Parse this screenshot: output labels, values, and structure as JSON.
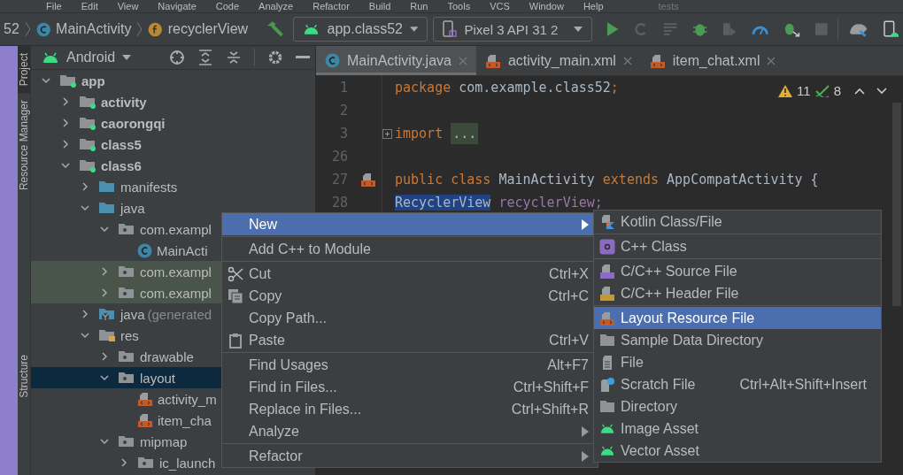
{
  "menu_bar": [
    {
      "label": "File"
    },
    {
      "label": "Edit"
    },
    {
      "label": "View"
    },
    {
      "label": "Navigate"
    },
    {
      "label": "Code"
    },
    {
      "label": "Analyze"
    },
    {
      "label": "Refactor"
    },
    {
      "label": "Build"
    },
    {
      "label": "Run"
    },
    {
      "label": "Tools"
    },
    {
      "label": "VCS"
    },
    {
      "label": "Window"
    },
    {
      "label": "Help"
    }
  ],
  "window": {
    "title": "tests"
  },
  "breadcrumbs": [
    {
      "label": "52",
      "kind": "text"
    },
    {
      "label": "MainActivity",
      "kind": "class"
    },
    {
      "label": "recyclerView",
      "kind": "field"
    }
  ],
  "run_config": {
    "label": "app.class52"
  },
  "device": {
    "label": "Pixel 3 API 31 2"
  },
  "tool_strip": [
    {
      "label": "Project",
      "selected": true
    },
    {
      "label": "Resource Manager",
      "selected": false
    },
    {
      "label": "Structure",
      "selected": false
    }
  ],
  "project_panel": {
    "view": "Android",
    "tree": [
      {
        "label": "app",
        "kind": "module",
        "expanded": true,
        "selected": false,
        "marked": false,
        "children": [
          {
            "label": "activity",
            "kind": "module",
            "expanded": false,
            "selected": false,
            "marked": false
          },
          {
            "label": "caorongqi",
            "kind": "module",
            "expanded": false,
            "selected": false,
            "marked": false
          },
          {
            "label": "class5",
            "kind": "module",
            "expanded": false,
            "selected": false,
            "marked": false
          },
          {
            "label": "class6",
            "kind": "module",
            "expanded": true,
            "selected": false,
            "marked": false,
            "children": [
              {
                "label": "manifests",
                "kind": "source-folder",
                "expanded": false,
                "selected": false,
                "marked": false
              },
              {
                "label": "java",
                "kind": "source-folder",
                "expanded": true,
                "selected": false,
                "marked": false,
                "children": [
                  {
                    "label": "com.exampl",
                    "kind": "package",
                    "expanded": true,
                    "selected": false,
                    "marked": false,
                    "children": [
                      {
                        "label": "MainActi",
                        "kind": "class",
                        "selected": false,
                        "marked": false
                      }
                    ]
                  },
                  {
                    "label": "com.exampl",
                    "kind": "package",
                    "expanded": false,
                    "selected": false,
                    "marked": true
                  },
                  {
                    "label": "com.exampl",
                    "kind": "package",
                    "expanded": false,
                    "selected": false,
                    "marked": true
                  }
                ]
              },
              {
                "label": "java",
                "note": "(generated",
                "kind": "generated",
                "expanded": false,
                "selected": false,
                "marked": false
              },
              {
                "label": "res",
                "kind": "res",
                "expanded": true,
                "selected": false,
                "marked": false,
                "children": [
                  {
                    "label": "drawable",
                    "kind": "package",
                    "expanded": false,
                    "selected": false,
                    "marked": false
                  },
                  {
                    "label": "layout",
                    "kind": "package",
                    "expanded": true,
                    "selected": true,
                    "marked": false,
                    "children": [
                      {
                        "label": "activity_m",
                        "kind": "layout",
                        "selected": false,
                        "marked": false
                      },
                      {
                        "label": "item_cha",
                        "kind": "layout",
                        "selected": false,
                        "marked": false
                      }
                    ]
                  },
                  {
                    "label": "mipmap",
                    "kind": "package",
                    "expanded": true,
                    "selected": false,
                    "marked": false,
                    "children": [
                      {
                        "label": "ic_launch",
                        "kind": "package",
                        "expanded": false,
                        "selected": false,
                        "marked": false
                      }
                    ]
                  }
                ]
              }
            ]
          }
        ]
      }
    ]
  },
  "editor": {
    "tabs": [
      {
        "label": "MainActivity.java",
        "kind": "class",
        "selected": true
      },
      {
        "label": "activity_main.xml",
        "kind": "layout",
        "selected": false
      },
      {
        "label": "item_chat.xml",
        "kind": "layout",
        "selected": false
      }
    ],
    "warnings": "11",
    "weak_warnings": "8",
    "lines": [
      {
        "number": "1",
        "tokens": [
          {
            "text": "package ",
            "kind": "keyword"
          },
          {
            "text": "com.example.class52",
            "kind": "plain"
          },
          {
            "text": ";",
            "kind": "keyword"
          }
        ]
      },
      {
        "number": "2"
      },
      {
        "number": "3",
        "fold": true,
        "tokens": [
          {
            "text": "import ",
            "kind": "keyword"
          },
          {
            "text": "...",
            "kind": "folded"
          }
        ]
      },
      {
        "number": "26"
      },
      {
        "number": "27",
        "linked_layout": true,
        "tokens": [
          {
            "text": "public class ",
            "kind": "keyword"
          },
          {
            "text": "MainActivity ",
            "kind": "plain"
          },
          {
            "text": "extends ",
            "kind": "keyword"
          },
          {
            "text": "AppCompatActivity {",
            "kind": "plain"
          }
        ]
      },
      {
        "number": "28",
        "tokens": [
          {
            "text": "RecyclerView",
            "kind": "selected"
          },
          {
            "text": " recyclerView;",
            "kind": "field"
          }
        ]
      }
    ]
  },
  "context_menu": [
    {
      "kind": "item",
      "label": "New",
      "selected": true,
      "submenu": true
    },
    {
      "kind": "separator"
    },
    {
      "kind": "item",
      "label": "Add C++ to Module",
      "selected": false
    },
    {
      "kind": "separator"
    },
    {
      "kind": "cut",
      "label": "Cut",
      "shortcut": "Ctrl+X",
      "selected": false
    },
    {
      "kind": "copy",
      "label": "Copy",
      "shortcut": "Ctrl+C",
      "selected": false
    },
    {
      "kind": "item",
      "label": "Copy Path...",
      "selected": false
    },
    {
      "kind": "paste",
      "label": "Paste",
      "shortcut": "Ctrl+V",
      "selected": false
    },
    {
      "kind": "separator"
    },
    {
      "kind": "item",
      "label": "Find Usages",
      "shortcut": "Alt+F7",
      "selected": false
    },
    {
      "kind": "item",
      "label": "Find in Files...",
      "shortcut": "Ctrl+Shift+F",
      "selected": false
    },
    {
      "kind": "item",
      "label": "Replace in Files...",
      "shortcut": "Ctrl+Shift+R",
      "selected": false
    },
    {
      "kind": "item",
      "label": "Analyze",
      "selected": false,
      "submenu": true
    },
    {
      "kind": "separator"
    },
    {
      "kind": "item",
      "label": "Refactor",
      "selected": false,
      "submenu": true
    }
  ],
  "new_submenu": [
    {
      "kind": "kotlin",
      "label": "Kotlin Class/File",
      "selected": false
    },
    {
      "kind": "separator"
    },
    {
      "kind": "cpp-class",
      "label": "C++ Class",
      "selected": false
    },
    {
      "kind": "separator"
    },
    {
      "kind": "cpp-source",
      "label": "C/C++ Source File",
      "selected": false
    },
    {
      "kind": "cpp-header",
      "label": "C/C++ Header File",
      "selected": false
    },
    {
      "kind": "separator"
    },
    {
      "kind": "layout",
      "label": "Layout Resource File",
      "selected": true
    },
    {
      "kind": "folder",
      "label": "Sample Data Directory",
      "selected": false
    },
    {
      "kind": "file",
      "label": "File",
      "selected": false
    },
    {
      "kind": "scratch",
      "label": "Scratch File",
      "shortcut": "Ctrl+Alt+Shift+Insert",
      "selected": false
    },
    {
      "kind": "folder",
      "label": "Directory",
      "selected": false
    },
    {
      "kind": "android",
      "label": "Image Asset",
      "selected": false
    },
    {
      "kind": "android",
      "label": "Vector Asset",
      "selected": false
    }
  ]
}
